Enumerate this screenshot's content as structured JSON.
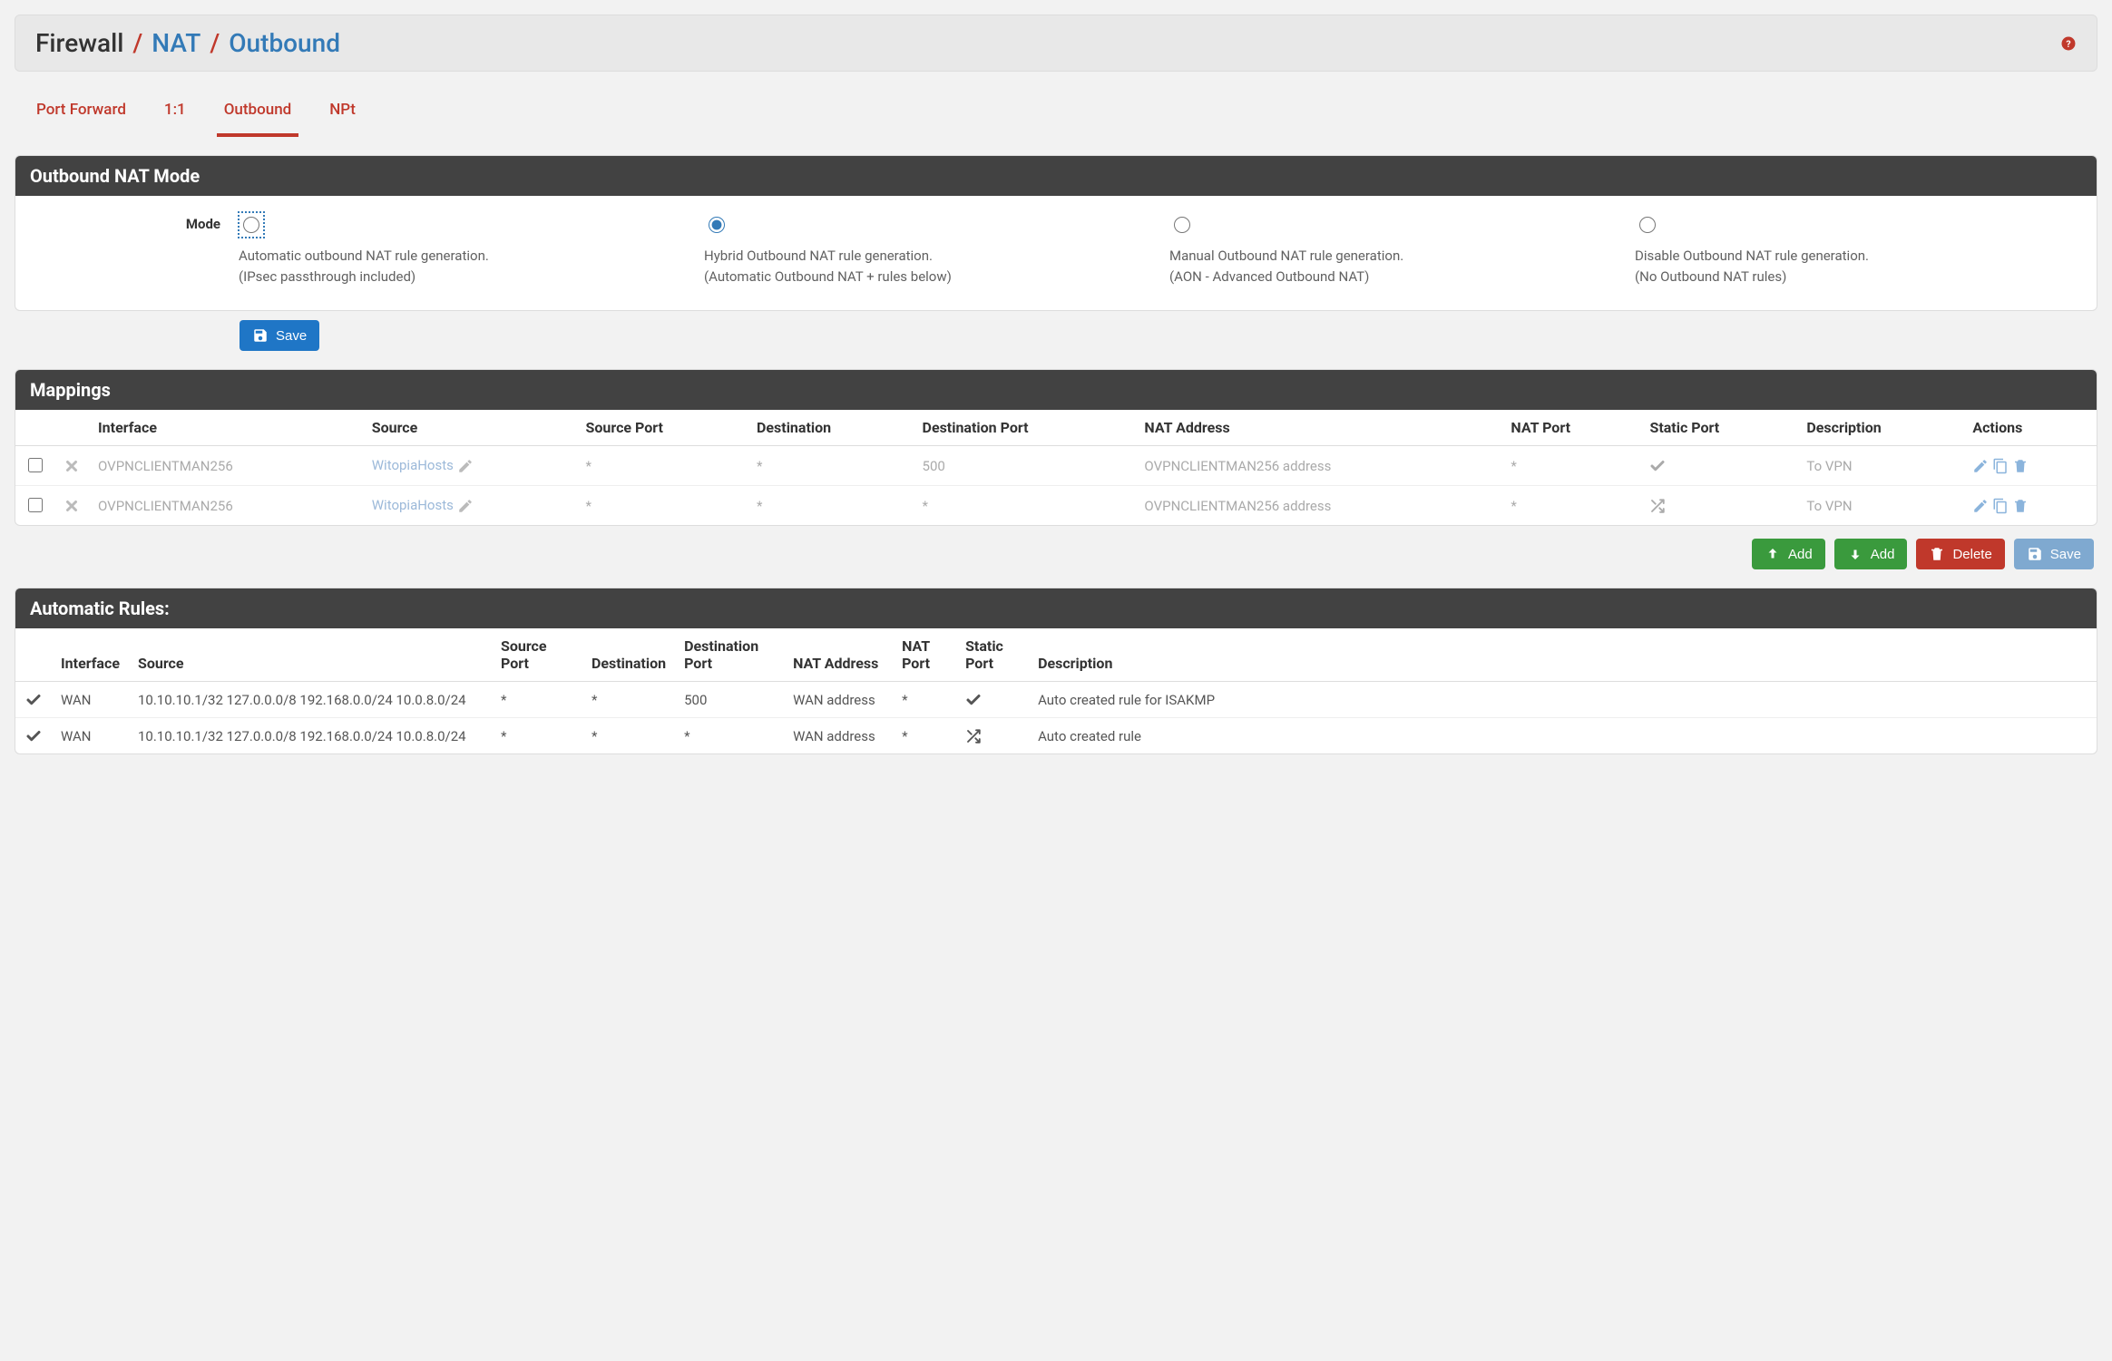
{
  "breadcrumb": {
    "root": "Firewall",
    "sep": "/",
    "level1": "NAT",
    "level2": "Outbound"
  },
  "tabs": [
    {
      "label": "Port Forward"
    },
    {
      "label": "1:1"
    },
    {
      "label": "Outbound",
      "active": true
    },
    {
      "label": "NPt"
    }
  ],
  "mode_panel": {
    "title": "Outbound NAT Mode",
    "label": "Mode",
    "options": [
      {
        "desc": "Automatic outbound NAT rule generation.\n(IPsec passthrough included)"
      },
      {
        "desc": "Hybrid Outbound NAT rule generation.\n(Automatic Outbound NAT + rules below)",
        "checked": true
      },
      {
        "desc": "Manual Outbound NAT rule generation.\n(AON - Advanced Outbound NAT)"
      },
      {
        "desc": "Disable Outbound NAT rule generation.\n(No Outbound NAT rules)"
      }
    ],
    "save_label": "Save"
  },
  "mappings_panel": {
    "title": "Mappings",
    "headers": {
      "interface": "Interface",
      "source": "Source",
      "source_port": "Source Port",
      "destination": "Destination",
      "destination_port": "Destination Port",
      "nat_address": "NAT Address",
      "nat_port": "NAT Port",
      "static_port": "Static Port",
      "description": "Description",
      "actions": "Actions"
    },
    "rows": [
      {
        "interface": "OVPNCLIENTMAN256",
        "source": "WitopiaHosts",
        "source_port": "*",
        "destination": "*",
        "destination_port": "500",
        "nat_address": "OVPNCLIENTMAN256 address",
        "nat_port": "*",
        "static_port": "check",
        "description": "To VPN"
      },
      {
        "interface": "OVPNCLIENTMAN256",
        "source": "WitopiaHosts",
        "source_port": "*",
        "destination": "*",
        "destination_port": "*",
        "nat_address": "OVPNCLIENTMAN256 address",
        "nat_port": "*",
        "static_port": "shuffle",
        "description": "To VPN"
      }
    ],
    "buttons": {
      "add_top": "Add",
      "add_bottom": "Add",
      "delete": "Delete",
      "save": "Save"
    }
  },
  "auto_panel": {
    "title": "Automatic Rules:",
    "headers": {
      "interface": "Interface",
      "source": "Source",
      "source_port": "Source Port",
      "destination": "Destination",
      "destination_port": "Destination Port",
      "nat_address": "NAT Address",
      "nat_port": "NAT Port",
      "static_port": "Static Port",
      "description": "Description"
    },
    "rows": [
      {
        "interface": "WAN",
        "source": "10.10.10.1/32 127.0.0.0/8 192.168.0.0/24 10.0.8.0/24",
        "source_port": "*",
        "destination": "*",
        "destination_port": "500",
        "nat_address": "WAN address",
        "nat_port": "*",
        "static_port": "check",
        "description": "Auto created rule for ISAKMP"
      },
      {
        "interface": "WAN",
        "source": "10.10.10.1/32 127.0.0.0/8 192.168.0.0/24 10.0.8.0/24",
        "source_port": "*",
        "destination": "*",
        "destination_port": "*",
        "nat_address": "WAN address",
        "nat_port": "*",
        "static_port": "shuffle",
        "description": "Auto created rule"
      }
    ]
  }
}
